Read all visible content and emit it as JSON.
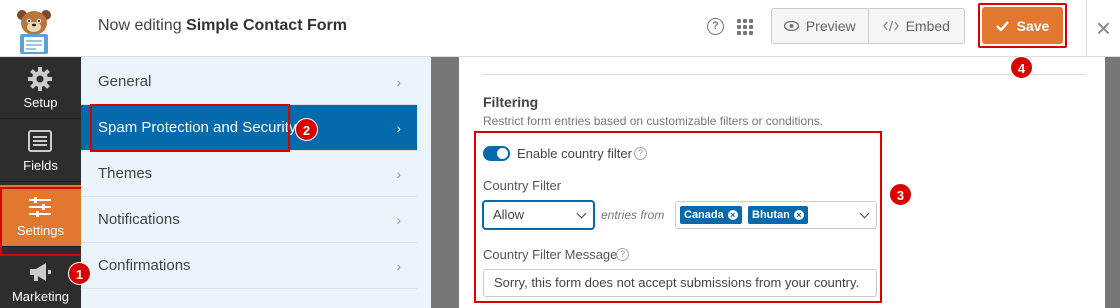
{
  "header": {
    "title_prefix": "Now editing",
    "form_name": "Simple Contact Form",
    "help_icon": "?",
    "preview_label": "Preview",
    "embed_label": "Embed",
    "save_label": "Save",
    "close_icon": "×"
  },
  "icon_nav": [
    {
      "label": "Setup",
      "icon": "gear-icon"
    },
    {
      "label": "Fields",
      "icon": "list-icon"
    },
    {
      "label": "Settings",
      "icon": "sliders-icon",
      "active": true
    },
    {
      "label": "Marketing",
      "icon": "megaphone-icon"
    }
  ],
  "settings_panel": {
    "items": [
      {
        "label": "General"
      },
      {
        "label": "Spam Protection and Security",
        "active": true
      },
      {
        "label": "Themes"
      },
      {
        "label": "Notifications"
      },
      {
        "label": "Confirmations"
      }
    ]
  },
  "filtering": {
    "title": "Filtering",
    "description": "Restrict form entries based on customizable filters or conditions.",
    "enable_label": "Enable country filter",
    "enabled": true,
    "country_filter_label": "Country Filter",
    "mode_value": "Allow",
    "entries_from": "entries from",
    "countries": [
      "Canada",
      "Bhutan"
    ],
    "message_label": "Country Filter Message",
    "message_value": "Sorry, this form does not accept submissions from your country."
  },
  "annotations": [
    "1",
    "2",
    "3",
    "4"
  ],
  "colors": {
    "accent_orange": "#e27730",
    "accent_blue": "#036aab",
    "highlight_red": "#d90000",
    "nav_dark": "#2d2d2d"
  }
}
